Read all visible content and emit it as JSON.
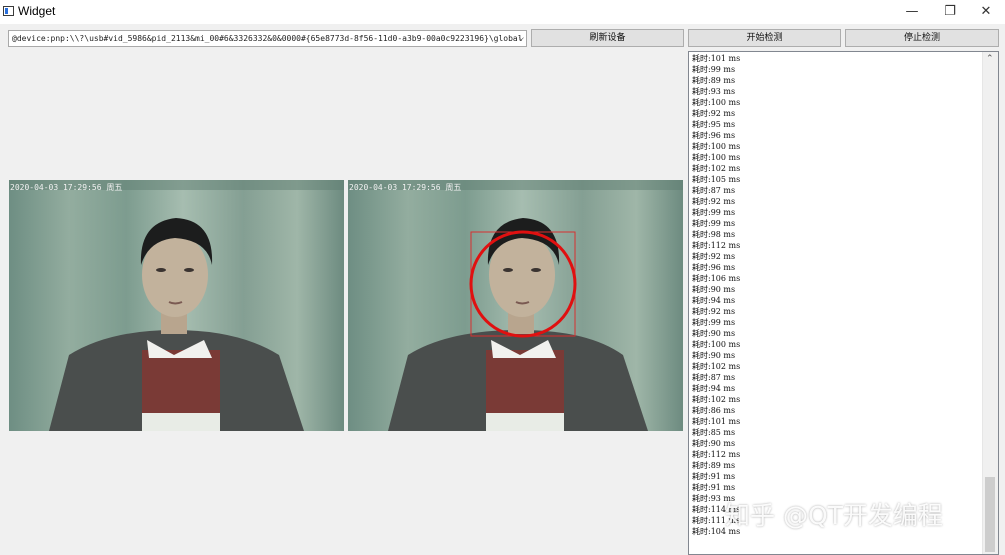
{
  "window": {
    "title": "Widget",
    "minimize_glyph": "—",
    "maximize_glyph": "❐",
    "close_glyph": "✕",
    "app_icon": "widget-window-icon"
  },
  "toolbar": {
    "device_value": "@device:pnp:\\\\?\\usb#vid_5986&pid_2113&mi_00#6&3326332&0&0000#{65e8773d-8f56-11d0-a3b9-00a0c9223196}\\global",
    "refresh_label": "刷新设备",
    "start_label": "开始检测",
    "stop_label": "停止检测"
  },
  "video_left": {
    "timestamp": "2020-04-03 17:29:56 周五"
  },
  "video_right": {
    "timestamp": "2020-04-03 17:29:56 周五"
  },
  "log": {
    "prefix": "耗时:",
    "unit": " ms",
    "values": [
      101,
      99,
      89,
      93,
      100,
      92,
      95,
      96,
      100,
      100,
      102,
      105,
      87,
      92,
      99,
      99,
      98,
      112,
      92,
      96,
      106,
      90,
      94,
      92,
      99,
      90,
      100,
      90,
      102,
      87,
      94,
      102,
      86,
      101,
      85,
      90,
      112,
      89,
      91,
      91,
      93,
      114,
      111,
      104
    ]
  },
  "watermark": "知乎 @QT开发编程",
  "colors": {
    "face_box": "#d83030",
    "face_circle": "#e01010"
  }
}
